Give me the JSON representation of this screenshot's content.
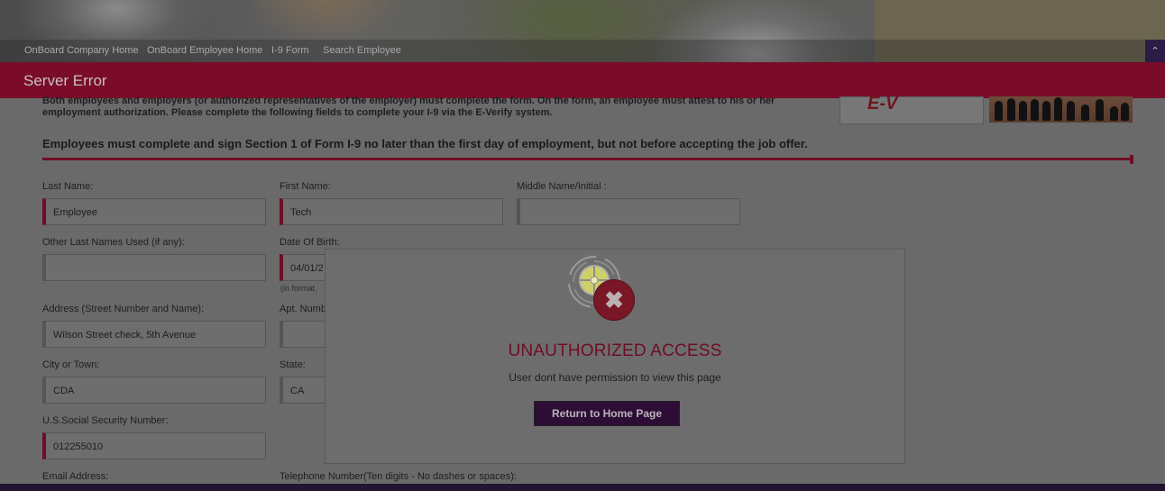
{
  "nav": {
    "links": [
      "OnBoard Company Home",
      "OnBoard Employee Home",
      "I-9 Form",
      "Search Employee"
    ]
  },
  "page_title": "Server Error",
  "intro_text": "Both employees and employers (or authorized representatives of the employer) must complete the form. On the form, an employee must attest to his or her employment authorization. Please complete the following fields to complete your I-9 via the E-Verify system.",
  "deadline_text": "Employees must complete and sign Section 1 of Form I-9 no later than the first day of employment, but not before accepting the job offer.",
  "form": {
    "last_name": {
      "label": "Last Name:",
      "value": "Employee"
    },
    "first_name": {
      "label": "First Name:",
      "value": "Tech"
    },
    "middle_name": {
      "label": "Middle Name/Initial :",
      "value": ""
    },
    "other_last_names": {
      "label": "Other Last Names Used (if any):",
      "value": ""
    },
    "dob": {
      "label": "Date Of Birth:",
      "value": "04/01/2",
      "hint": "(in format."
    },
    "address": {
      "label": "Address (Street Number and Name):",
      "value": "Wilson Street check, 5th Avenue"
    },
    "apt": {
      "label": "Apt. Numb",
      "value": ""
    },
    "city": {
      "label": "City or Town:",
      "value": "CDA"
    },
    "state": {
      "label": "State:",
      "value": "CA"
    },
    "ssn": {
      "label": "U.S.Social Security Number:",
      "value": "012255010"
    },
    "email": {
      "label": "Email Address:"
    },
    "phone": {
      "label": "Telephone Number(Ten digits - No dashes or spaces):"
    }
  },
  "modal": {
    "title": "UNAUTHORIZED ACCESS",
    "message": "User dont have permission to view this page",
    "button": "Return to Home Page",
    "error_glyph": "✖"
  },
  "logo_text": "E-V",
  "colors": {
    "brand": "#7a0c2a",
    "button": "#2d0d36",
    "overlay": "#6b6b6b"
  }
}
